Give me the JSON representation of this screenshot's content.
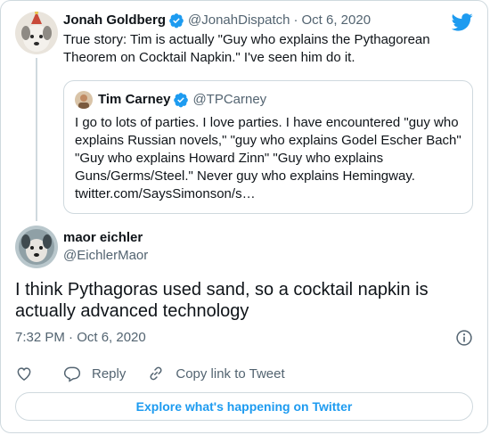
{
  "parent_tweet": {
    "name": "Jonah Goldberg",
    "handle": "@JonahDispatch",
    "separator": "·",
    "date": "Oct 6, 2020",
    "text": "True story: Tim is actually \"Guy who explains the Pythagorean Theorem on Cocktail Napkin.\" I've seen him do it."
  },
  "quoted_tweet": {
    "name": "Tim Carney",
    "handle": "@TPCarney",
    "text": "I go to lots of parties. I love parties. I have encountered \"guy who explains Russian novels,\" \"guy who explains Godel Escher Bach\" \"Guy who explains Howard Zinn\" \"Guy who explains Guns/Germs/Steel.\" Never guy who explains Hemingway. twitter.com/SaysSimonson/s…"
  },
  "reply_tweet": {
    "name": "maor eichler",
    "handle": "@EichlerMaor",
    "text": "I think Pythagoras used sand, so a cocktail napkin is actually advanced technology",
    "timestamp": "7:32 PM · Oct 6, 2020"
  },
  "actions": {
    "reply_label": "Reply",
    "copy_link_label": "Copy link to Tweet"
  },
  "footer": {
    "explore_label": "Explore what's happening on Twitter"
  },
  "colors": {
    "twitter_blue": "#1d9bf0",
    "secondary_text": "#536471",
    "border": "#cfd9de"
  },
  "icons": [
    "twitter-bird-icon",
    "verified-badge-icon",
    "info-icon",
    "heart-icon",
    "reply-icon",
    "link-icon"
  ]
}
